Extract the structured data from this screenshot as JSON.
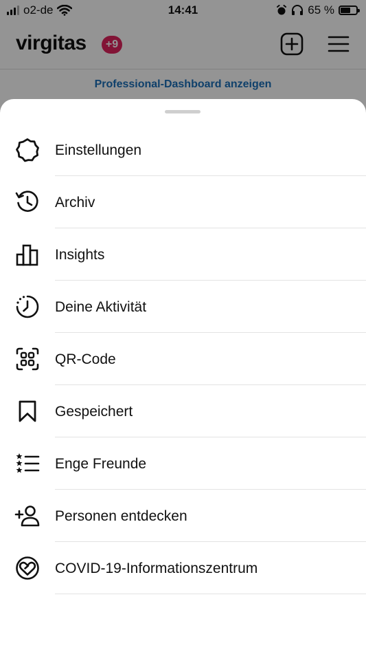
{
  "status_bar": {
    "carrier": "o2-de",
    "time": "14:41",
    "battery_percent": "65 %",
    "battery_level": 0.65
  },
  "header": {
    "username": "virgitas",
    "notification_badge": "+9",
    "add_icon": "plus-square-icon",
    "menu_icon": "hamburger-menu-icon"
  },
  "banner": {
    "professional_dashboard": "Professional-Dashboard anzeigen"
  },
  "menu": {
    "items": [
      {
        "label": "Einstellungen",
        "icon": "gear-icon"
      },
      {
        "label": "Archiv",
        "icon": "archive-history-icon"
      },
      {
        "label": "Insights",
        "icon": "bar-chart-icon"
      },
      {
        "label": "Deine Aktivität",
        "icon": "activity-clock-icon"
      },
      {
        "label": "QR-Code",
        "icon": "qr-code-icon"
      },
      {
        "label": "Gespeichert",
        "icon": "bookmark-icon"
      },
      {
        "label": "Enge Freunde",
        "icon": "close-friends-list-icon"
      },
      {
        "label": "Personen entdecken",
        "icon": "add-person-icon"
      },
      {
        "label": "COVID-19-Informationszentrum",
        "icon": "covid-heart-icon"
      }
    ]
  },
  "colors": {
    "badge": "#e0245e",
    "link": "#1a6fb8"
  }
}
